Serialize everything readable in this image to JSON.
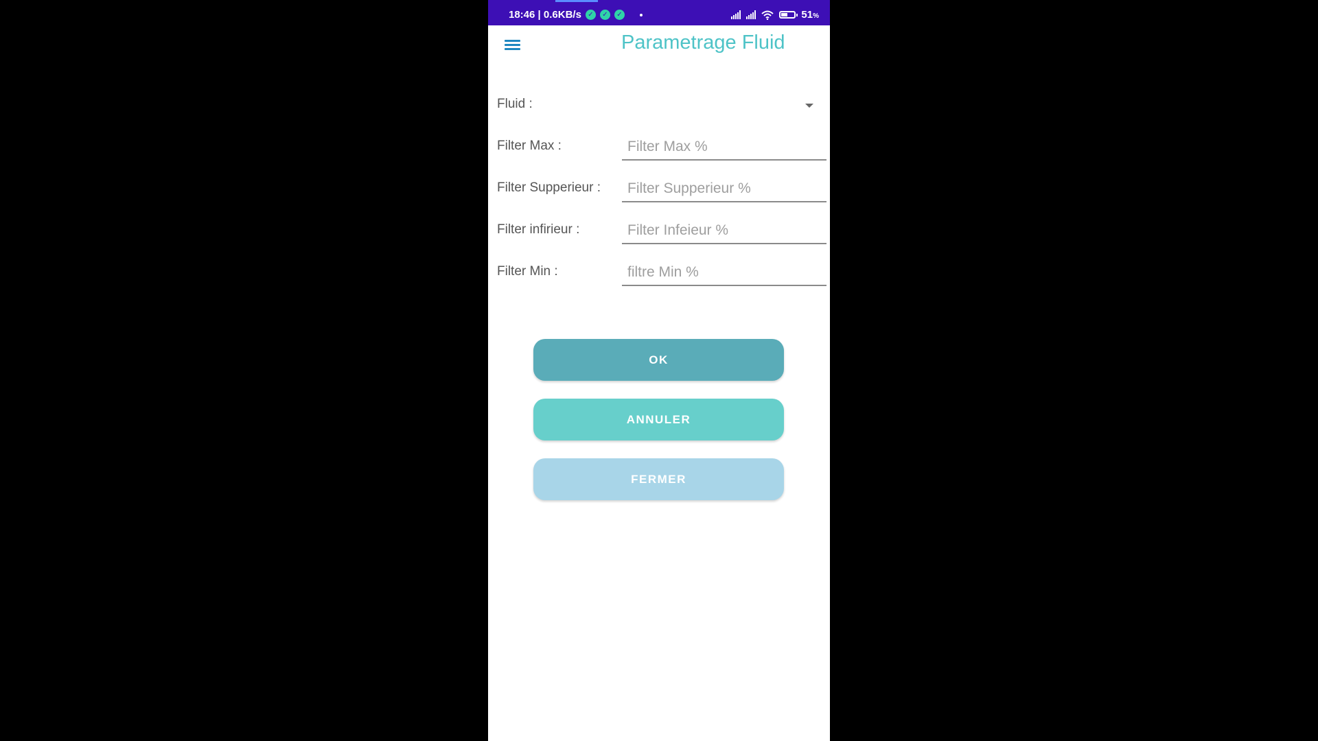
{
  "status_bar": {
    "time_and_speed": "18:46 | 0.6KB/s",
    "battery_percent": "51",
    "battery_unit": "%",
    "battery_level": 0.51,
    "icons": [
      "check-circle-icon",
      "check-circle-icon",
      "check-circle-icon",
      "signal-icon",
      "signal-icon",
      "wifi-icon",
      "battery-icon"
    ]
  },
  "app_bar": {
    "title": "Parametrage Fluid",
    "menu_icon": "hamburger-menu-icon"
  },
  "form": {
    "fluid": {
      "label": "Fluid :",
      "value": ""
    },
    "filter_max": {
      "label": "Filter Max :",
      "placeholder": "Filter Max %"
    },
    "filter_superieur": {
      "label": "Filter Supperieur :",
      "placeholder": "Filter Supperieur %"
    },
    "filter_inferieur": {
      "label": "Filter infirieur :",
      "placeholder": "Filter Infeieur %"
    },
    "filter_min": {
      "label": "Filter Min :",
      "placeholder": "filtre Min %"
    }
  },
  "buttons": {
    "ok": "OK",
    "annuler": "ANNULER",
    "fermer": "FERMER"
  },
  "colors": {
    "status_bar": "#3d0fb5",
    "title": "#4ec3c7",
    "ok_button": "#5aacb8",
    "annuler_button": "#67cfcb",
    "fermer_button": "#a8d5e8"
  }
}
